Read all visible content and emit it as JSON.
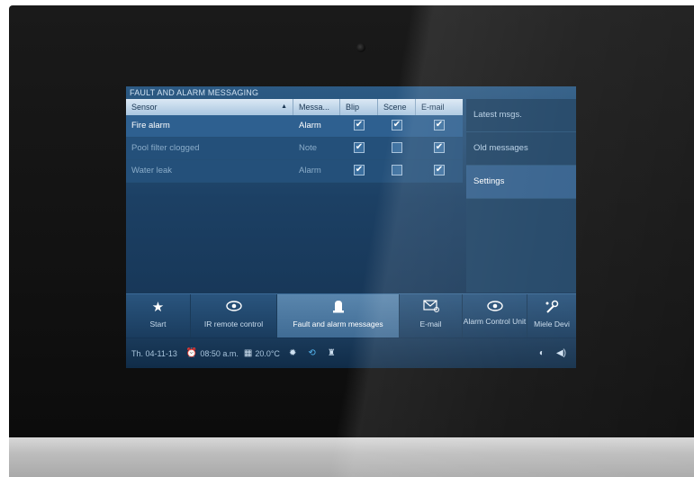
{
  "screen_title": "FAULT AND ALARM MESSAGING",
  "table": {
    "headers": [
      "Sensor",
      "Messa...",
      "Blip",
      "Scene",
      "E-mail"
    ],
    "rows": [
      {
        "sensor": "Fire alarm",
        "message": "Alarm",
        "blip": true,
        "scene": true,
        "email": true
      },
      {
        "sensor": "Pool filter clogged",
        "message": "Note",
        "blip": true,
        "scene": false,
        "email": true
      },
      {
        "sensor": "Water leak",
        "message": "Alarm",
        "blip": true,
        "scene": false,
        "email": true
      }
    ]
  },
  "side_menu": {
    "items": [
      {
        "label": "Latest msgs."
      },
      {
        "label": "Old messages"
      },
      {
        "label": "Settings"
      }
    ],
    "selected": "Settings"
  },
  "nav": {
    "items": [
      {
        "icon": "star-icon",
        "label": "Start"
      },
      {
        "icon": "eye-icon",
        "label": "IR remote control"
      },
      {
        "icon": "alarm-bell-icon",
        "label": "Fault and alarm messages"
      },
      {
        "icon": "email-icon",
        "label": "E-mail"
      },
      {
        "icon": "eye-icon",
        "label": "Alarm Control Unit"
      },
      {
        "icon": "wrench-icon",
        "label": "Miele Devi"
      }
    ],
    "selected": "Fault and alarm messages"
  },
  "status": {
    "date": "Th. 04-11-13",
    "time": "08:50 a.m.",
    "temperature": "20.0°C"
  },
  "colors": {
    "screen_bg": "#1c4064",
    "header_bg": "#c4d8ea",
    "selected_row": "#2e6090"
  }
}
